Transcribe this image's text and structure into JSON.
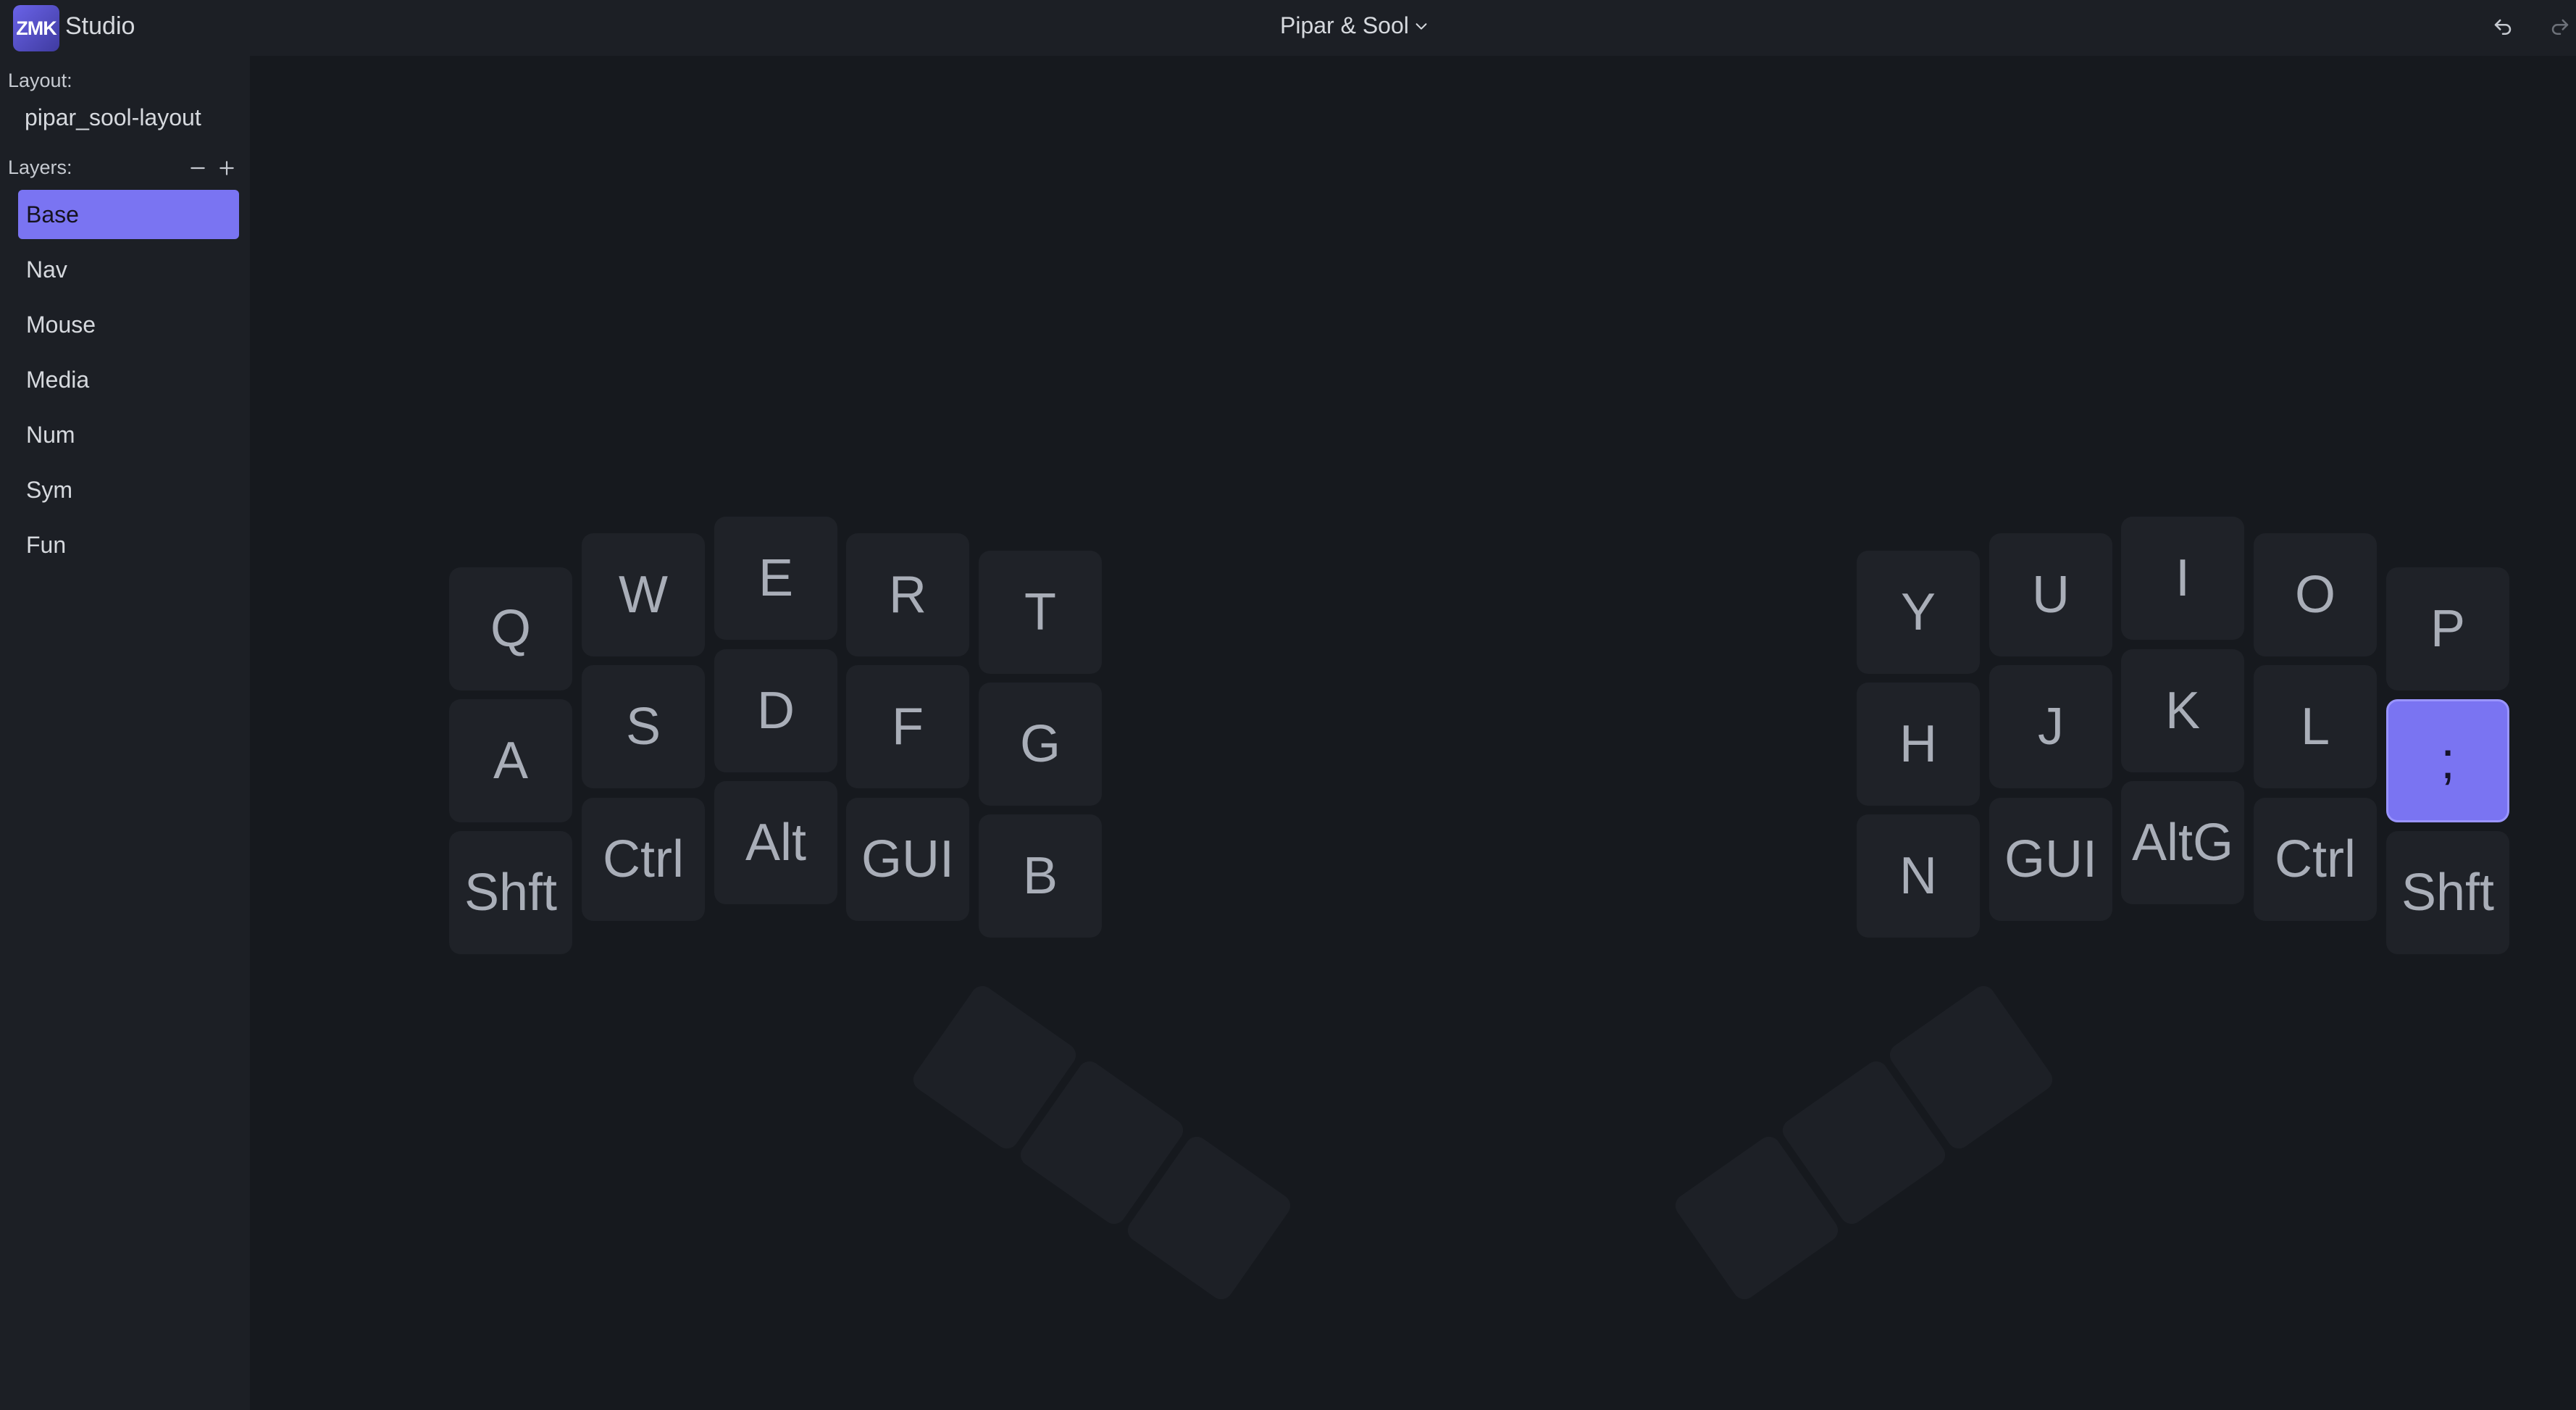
{
  "header": {
    "logo_text": "ZMK",
    "app_name": "Studio",
    "device_name": "Pipar & Sool"
  },
  "sidebar": {
    "layout_label": "Layout:",
    "layout_value": "pipar_sool-layout",
    "layers_label": "Layers:",
    "layers": [
      {
        "label": "Base",
        "selected": true
      },
      {
        "label": "Nav",
        "selected": false
      },
      {
        "label": "Mouse",
        "selected": false
      },
      {
        "label": "Media",
        "selected": false
      },
      {
        "label": "Num",
        "selected": false
      },
      {
        "label": "Sym",
        "selected": false
      },
      {
        "label": "Fun",
        "selected": false
      }
    ]
  },
  "keymap": {
    "left_row1": [
      "Q",
      "W",
      "E",
      "R",
      "T"
    ],
    "left_row2": [
      "A",
      "S",
      "D",
      "F",
      "G"
    ],
    "left_row3": [
      "Shft",
      "Ctrl",
      "Alt",
      "GUI",
      "B"
    ],
    "right_row1": [
      "Y",
      "U",
      "I",
      "O",
      "P"
    ],
    "right_row2": [
      "H",
      "J",
      "K",
      "L",
      ";"
    ],
    "right_row3": [
      "N",
      "GUI",
      "AltG",
      "Ctrl",
      "Shft"
    ],
    "thumbs_left": [
      "",
      "",
      ""
    ],
    "thumbs_right": [
      "",
      "",
      ""
    ],
    "selected_key": ";"
  },
  "colors": {
    "accent": "#7a74f2",
    "background": "#16191e",
    "panel": "#1c1f25",
    "key": "#1f2228"
  }
}
